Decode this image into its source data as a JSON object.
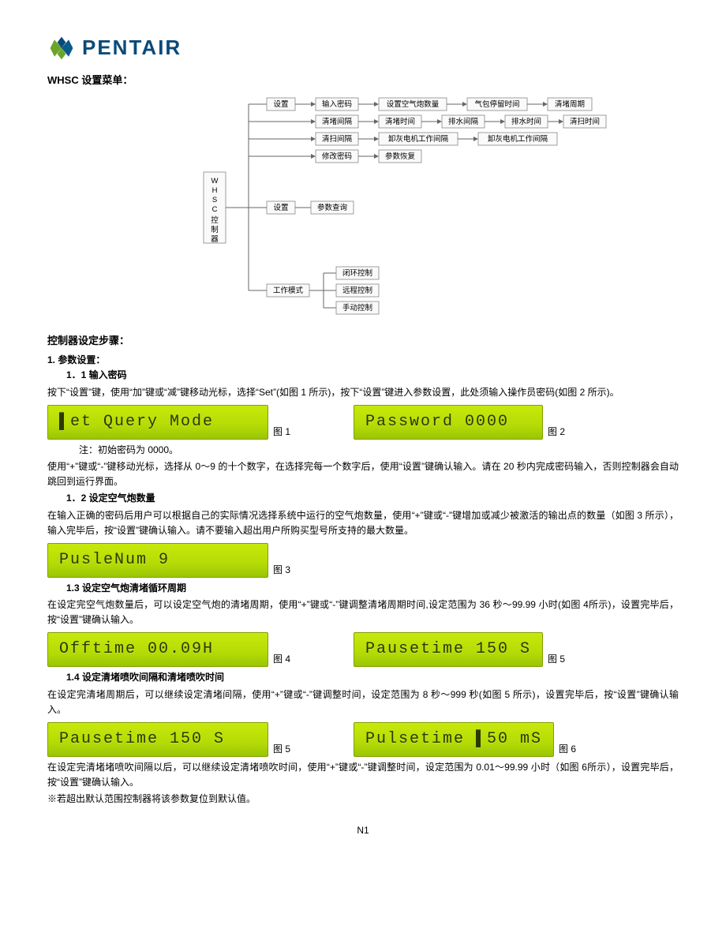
{
  "logo": {
    "text": "PENTAIR"
  },
  "titles": {
    "menu_title": "WHSC 设置菜单：",
    "steps_title": "控制器设定步骤：",
    "s1": "1. 参数设置：",
    "s1_1": "1．1 输入密码",
    "s1_2": "1．2 设定空气炮数量",
    "s1_3": "1.3 设定空气炮清堵循环周期",
    "s1_4": "1.4 设定清堵喷吹间隔和清堵喷吹时间"
  },
  "diagram": {
    "root": "WHSC 控制器",
    "row1": [
      "设置",
      "输入密码",
      "设置空气炮数量",
      "气包停留时间",
      "清堵周期"
    ],
    "row2": [
      "清堵间隔",
      "清堵时间",
      "排水间隔",
      "排水时间",
      "清扫时间"
    ],
    "row3": [
      "清扫间隔",
      "卸灰电机工作间隔",
      "卸灰电机工作间隔"
    ],
    "row4": [
      "修改密码",
      "参数恢复"
    ],
    "branch2": [
      "设置",
      "参数查询"
    ],
    "branch3_label": "工作模式",
    "branch3": [
      "闭环控制",
      "远程控制",
      "手动控制"
    ]
  },
  "text": {
    "p1": "按下“设置”键，使用“加”键或“减”键移动光标，选择“Set”(如图 1 所示)，按下“设置”键进入参数设置，此处须输入操作员密码(如图 2 所示)。",
    "note1": "注：初始密码为 0000。",
    "p2": "使用“+”键或“-”键移动光标，选择从 0～9 的十个数字，在选择完每一个数字后，使用“设置”键确认输入。请在 20 秒内完成密码输入，否则控制器会自动跳回到运行界面。",
    "p3": "在输入正确的密码后用户可以根据自己的实际情况选择系统中运行的空气炮数量，使用“+”键或“-”键增加或减少被激活的输出点的数量（如图 3 所示），输入完毕后，按“设置”键确认输入。请不要输入超出用户所购买型号所支持的最大数量。",
    "p4": "在设定完空气炮数量后，可以设定空气炮的清堵周期，使用“+”键或“-”键调整清堵周期时间,设定范围为 36 秒～99.99 小时(如图 4所示)，设置完毕后，按“设置”键确认输入。",
    "p5": "在设定完清堵周期后，可以继续设定清堵间隔，使用“+”键或“-”键调整时间，设定范围为 8 秒～999 秒(如图 5 所示)，设置完毕后，按“设置”键确认输入。",
    "p6": "在设定完清堵堵喷吹间隔以后，可以继续设定清堵喷吹时间，使用“+”键或“-”键调整时间，设定范围为 0.01～99.99 小时（如图 6所示），设置完毕后，按“设置”键确认输入。",
    "p7": "※若超出默认范围控制器将该参数复位到默认值。"
  },
  "lcd": {
    "fig1": "▌et Query Mode",
    "fig2": "Password    0000",
    "fig3": "PusleNum   9",
    "fig4": "Offtime   00.09H",
    "fig5": "Pausetime  150 S",
    "fig5b": "Pausetime  150 S",
    "fig6": "Pulsetime ▌50 mS"
  },
  "captions": {
    "f1": "图 1",
    "f2": "图 2",
    "f3": "图 3",
    "f4": "图 4",
    "f5": "图 5",
    "f5b": "图 5",
    "f6": "图 6"
  },
  "footer": "N1"
}
